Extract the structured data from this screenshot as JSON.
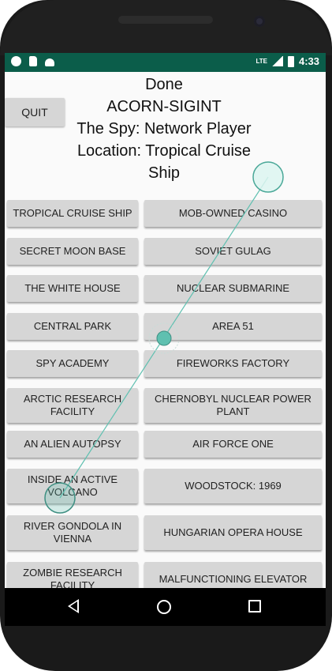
{
  "status_bar": {
    "time": "4:33",
    "network": "LTE",
    "icons": [
      "notification-dot-icon",
      "sd-card-icon",
      "android-icon",
      "signal-icon",
      "battery-icon"
    ]
  },
  "quit_label": "QUIT",
  "header": {
    "line1": "Done",
    "line2": "ACORN-SIGINT",
    "line3": "The Spy: Network Player",
    "line4": "Location: Tropical Cruise",
    "line5": "Ship"
  },
  "locations": [
    [
      "TROPICAL CRUISE SHIP",
      "MOB-OWNED CASINO"
    ],
    [
      "SECRET MOON BASE",
      "SOVIET GULAG"
    ],
    [
      "THE WHITE HOUSE",
      "NUCLEAR SUBMARINE"
    ],
    [
      "CENTRAL PARK",
      "AREA 51"
    ],
    [
      "SPY ACADEMY",
      "FIREWORKS FACTORY"
    ],
    [
      "ARCTIC RESEARCH FACILITY",
      "CHERNOBYL NUCLEAR POWER PLANT"
    ],
    [
      "AN ALIEN AUTOPSY",
      "AIR FORCE ONE"
    ],
    [
      "INSIDE AN ACTIVE VOLCANO",
      "WOODSTOCK: 1969"
    ],
    [
      "RIVER GONDOLA IN VIENNA",
      "HUNGARIAN OPERA HOUSE"
    ],
    [
      "ZOMBIE RESEARCH FACILITY",
      "MALFUNCTIONING ELEVATOR"
    ]
  ],
  "colors": {
    "status_bar": "#0b5d4a",
    "button": "#d6d6d6",
    "touch_indicator": "#5fc0b0"
  }
}
